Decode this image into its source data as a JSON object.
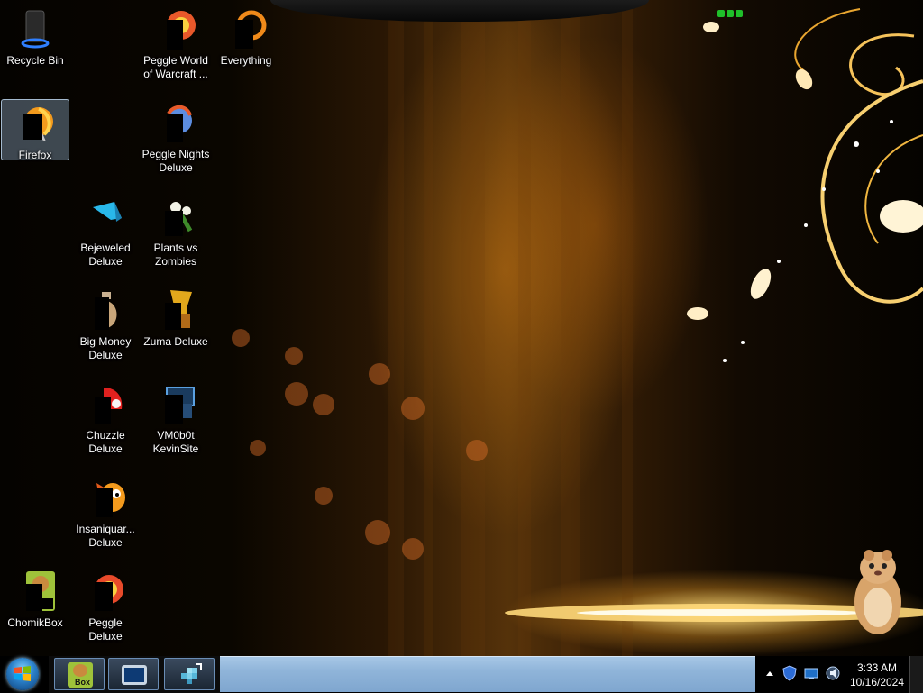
{
  "desktop": {
    "icons": [
      {
        "label": "Recycle Bin"
      },
      {
        "label": "Peggle World of Warcraft ..."
      },
      {
        "label": "Everything"
      },
      {
        "label": "Firefox"
      },
      {
        "label": "Peggle Nights Deluxe"
      },
      {
        "label": "Bejeweled Deluxe"
      },
      {
        "label": "Plants vs Zombies"
      },
      {
        "label": "Big Money Deluxe"
      },
      {
        "label": "Zuma Deluxe"
      },
      {
        "label": "Chuzzle Deluxe"
      },
      {
        "label": "VM0b0t KevinSite"
      },
      {
        "label": "Insaniquar... Deluxe"
      },
      {
        "label": "ChomikBox"
      },
      {
        "label": "Peggle Deluxe"
      }
    ]
  },
  "taskbar": {
    "start_icon": "windows-logo-icon",
    "pinned": [
      {
        "icon": "chomikbox-icon",
        "text": "Box"
      },
      {
        "icon": "monitor-icon"
      },
      {
        "icon": "network-cube-icon"
      }
    ],
    "tray_icons": [
      "show-hidden-icons-icon",
      "shield-icon",
      "network-icon",
      "volume-icon"
    ],
    "clock": {
      "time": "3:33 AM",
      "date": "10/16/2024"
    }
  },
  "colors": {
    "accent_gold": "#f5c25a",
    "taskbar_blue": "#8fb4d9",
    "selection": "#aac8e6"
  }
}
